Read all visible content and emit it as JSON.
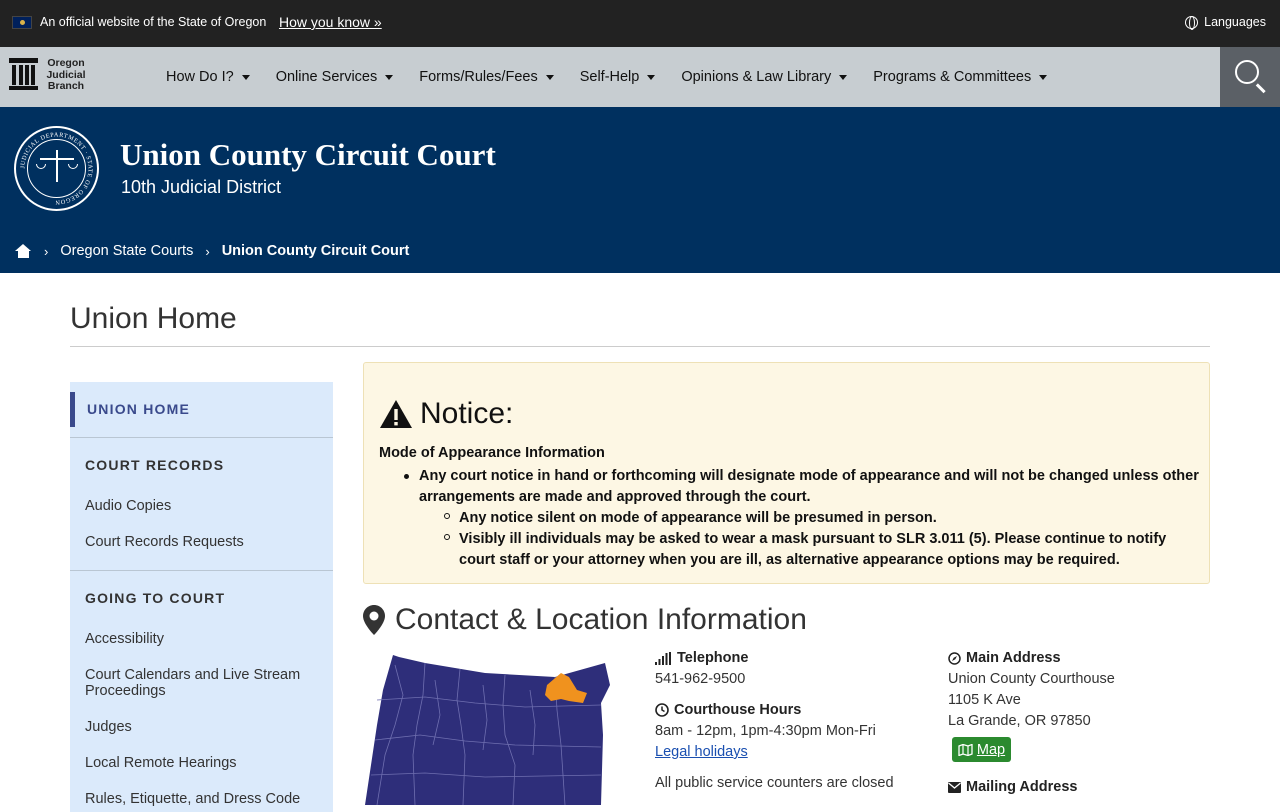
{
  "official_bar": {
    "text": "An official website of the State of Oregon",
    "how_you_know": "How you know »",
    "languages": "Languages"
  },
  "nav": {
    "logo_lines": [
      "Oregon",
      "Judicial",
      "Branch"
    ],
    "items": [
      {
        "label": "How Do I?"
      },
      {
        "label": "Online Services"
      },
      {
        "label": "Forms/Rules/Fees"
      },
      {
        "label": "Self-Help"
      },
      {
        "label": "Opinions & Law Library"
      },
      {
        "label": "Programs & Committees"
      }
    ]
  },
  "banner": {
    "title": "Union County Circuit Court",
    "subtitle": "10th Judicial District",
    "seal_text": "JUDICIAL DEPARTMENT · STATE OF OREGON"
  },
  "breadcrumb": {
    "items": [
      "Oregon State Courts",
      "Union County Circuit Court"
    ]
  },
  "page": {
    "title": "Union Home"
  },
  "sidebar": {
    "active": "UNION HOME",
    "sections": [
      {
        "heading": "COURT RECORDS",
        "items": [
          "Audio Copies",
          "Court Records Requests"
        ]
      },
      {
        "heading": "GOING TO COURT",
        "items": [
          "Accessibility",
          "Court Calendars and Live Stream Proceedings",
          "Judges",
          "Local Remote Hearings",
          "Rules, Etiquette, and Dress Code"
        ]
      }
    ]
  },
  "notice": {
    "heading": "Notice:",
    "subheading": "Mode of Appearance Information",
    "bullet": "Any court notice in hand or forthcoming will designate mode of appearance and will not be changed unless other arrangements are made and approved through the court.",
    "sub_bullets": [
      "Any notice silent on mode of appearance will be presumed in person.",
      "Visibly ill individuals may be asked to wear a mask pursuant to SLR 3.011 (5). Please continue to notify court staff or your attorney when you are ill, as alternative appearance options may be required."
    ]
  },
  "contact": {
    "heading": "Contact & Location Information",
    "telephone_label": "Telephone",
    "telephone": "541-962-9500",
    "hours_label": "Courthouse Hours",
    "hours": "8am - 12pm, 1pm-4:30pm Mon-Fri",
    "holidays_link": "Legal holidays",
    "counters_text": "All public service counters are closed",
    "main_address_label": "Main Address",
    "main_address": [
      "Union County Courthouse",
      "1105 K Ave",
      "La Grande, OR 97850"
    ],
    "map_button": "Map",
    "mailing_address_label": "Mailing Address"
  },
  "colors": {
    "banner": "#00305f",
    "nav": "#c7cdd1",
    "sidebar": "#dbeafb",
    "notice_bg": "#fdf7e4",
    "map_fill": "#2e2e7a",
    "map_highlight": "#f0921e",
    "map_button": "#2b8a2f"
  }
}
